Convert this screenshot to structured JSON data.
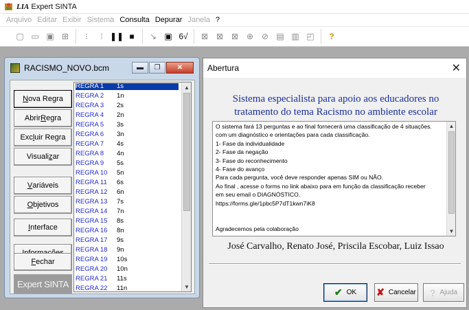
{
  "app": {
    "title_prefix": "LIA",
    "title_suffix": "Expert SINTA"
  },
  "menu": [
    {
      "label": "Arquivo",
      "enabled": false
    },
    {
      "label": "Editar",
      "enabled": false
    },
    {
      "label": "Exibir",
      "enabled": false
    },
    {
      "label": "Sistema",
      "enabled": false
    },
    {
      "label": "Consulta",
      "enabled": true
    },
    {
      "label": "Depurar",
      "enabled": true
    },
    {
      "label": "Janela",
      "enabled": false
    },
    {
      "label": "?",
      "enabled": true
    }
  ],
  "kb_window": {
    "title": "RACISMO_NOVO.bcm",
    "buttons": {
      "nova_regra": {
        "pre": "",
        "u": "N",
        "post": "ova Regra"
      },
      "abrir_regra": {
        "pre": "Abrir ",
        "u": "R",
        "post": "egra"
      },
      "excluir_regra": {
        "pre": "Exc",
        "u": "l",
        "post": "uir Regra"
      },
      "visualizar": {
        "pre": "Visuali",
        "u": "z",
        "post": "ar"
      },
      "variaveis": {
        "pre": "",
        "u": "V",
        "post": "ariáveis"
      },
      "objetivos": {
        "pre": "",
        "u": "O",
        "post": "bjetivos"
      },
      "interface": {
        "pre": "",
        "u": "I",
        "post": "nterface"
      },
      "informacoes": {
        "pre": "Infor",
        "u": "m",
        "post": "ações"
      },
      "fechar": {
        "pre": "",
        "u": "F",
        "post": "echar"
      }
    },
    "brand": "Expert SINTA",
    "rules": [
      {
        "name": "REGRA 1",
        "val": "1s"
      },
      {
        "name": "REGRA 2",
        "val": "1n"
      },
      {
        "name": "REGRA 3",
        "val": "2s"
      },
      {
        "name": "REGRA 4",
        "val": "2n"
      },
      {
        "name": "REGRA 5",
        "val": "3s"
      },
      {
        "name": "REGRA 6",
        "val": "3n"
      },
      {
        "name": "REGRA 7",
        "val": "4s"
      },
      {
        "name": "REGRA 8",
        "val": "4n"
      },
      {
        "name": "REGRA 9",
        "val": "5s"
      },
      {
        "name": "REGRA 10",
        "val": "5n"
      },
      {
        "name": "REGRA 11",
        "val": "6s"
      },
      {
        "name": "REGRA 12",
        "val": "6n"
      },
      {
        "name": "REGRA 13",
        "val": "7s"
      },
      {
        "name": "REGRA 14",
        "val": "7n"
      },
      {
        "name": "REGRA 15",
        "val": "8s"
      },
      {
        "name": "REGRA 16",
        "val": "8n"
      },
      {
        "name": "REGRA 17",
        "val": "9s"
      },
      {
        "name": "REGRA 18",
        "val": "9n"
      },
      {
        "name": "REGRA 19",
        "val": "10s"
      },
      {
        "name": "REGRA 20",
        "val": "10n"
      },
      {
        "name": "REGRA 21",
        "val": "11s"
      },
      {
        "name": "REGRA 22",
        "val": "11n"
      }
    ]
  },
  "dialog": {
    "title": "Abertura",
    "heading_line1": "Sistema especialista para apoio aos educadores  no",
    "heading_line2": "tratamento do tema Racismo no ambiente escolar",
    "text_lines": [
      "O sistema fará 13 perguntas e ao final fornecerá uma classificação de 4 situações.",
      "com um diagnóstico e orientações para cada classificação.",
      "   1- Fase da individualidade",
      "   2- Fase da negação",
      "   3- Fase do reconhecimento",
      "   4- Fase do avanço",
      "   Para cada pergunta, você deve responder apenas SIM ou NÃO.",
      "Ao final , acesse o forms no link abaixo para em função da classificação receber",
      "em seu email o DIAGNÓSTICO.",
      "https://forms.gle/1pbc5P7dT1kwn7iK8",
      "",
      "",
      "Agradecemos pela colaboração"
    ],
    "authors": "José Carvalho, Renato José, Priscila Escobar, Luiz Issao",
    "ok_label": "OK",
    "cancel_label": "Cancelar",
    "help_label": "Ajuda"
  },
  "colors": {
    "heading": "#1a2ea0",
    "rule_name": "#1f2ad0",
    "selection": "#0a3aa8"
  }
}
